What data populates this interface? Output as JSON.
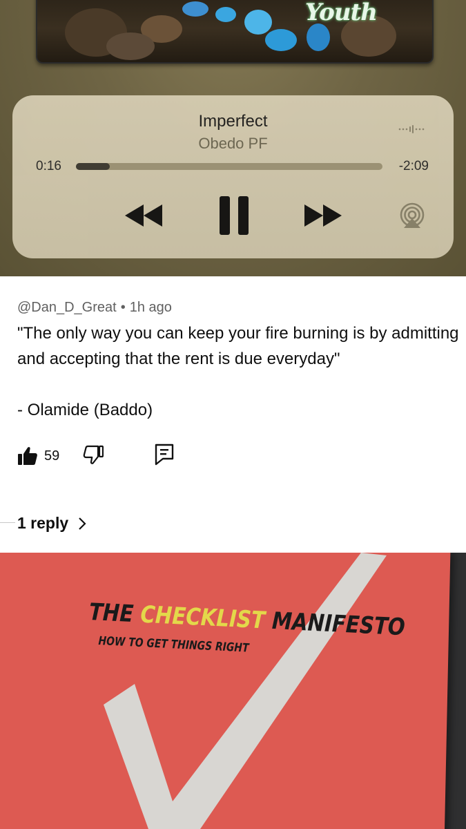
{
  "album": {
    "art_text": "Youth"
  },
  "player": {
    "title": "Imperfect",
    "artist": "Obedo PF",
    "elapsed": "0:16",
    "remaining": "-2:09",
    "progress_fraction": 0.11,
    "controls": {
      "rewind_icon": "rewind-icon",
      "pause_icon": "pause-icon",
      "forward_icon": "fast-forward-icon",
      "airplay_icon": "airplay-icon",
      "waveform_icon": "waveform-icon"
    },
    "colors": {
      "card": "#d8cfb5",
      "track": "#9f9578",
      "fill": "#3d3a33"
    }
  },
  "comment": {
    "author": "@Dan_D_Great",
    "separator": "•",
    "time": "1h ago",
    "text": "\"The only way you can keep your fire burning is by admitting and accepting that the rent is due everyday\"",
    "signature": "- Olamide (Baddo)",
    "like_count": "59",
    "replies_label": "1 reply",
    "chevron": "›",
    "icons": {
      "like": "thumbs-up-icon",
      "dislike": "thumbs-down-icon",
      "reply": "comment-icon",
      "more": "chevron-right-icon"
    }
  },
  "book": {
    "title_part1": "THE ",
    "title_highlight": "CHECKLIST",
    "title_part2": " MANIFESTO",
    "subtitle": "HOW TO GET THINGS RIGHT",
    "colors": {
      "cover": "#dd5a52",
      "highlight": "#e3d84a",
      "check": "#d8d6d2"
    }
  }
}
